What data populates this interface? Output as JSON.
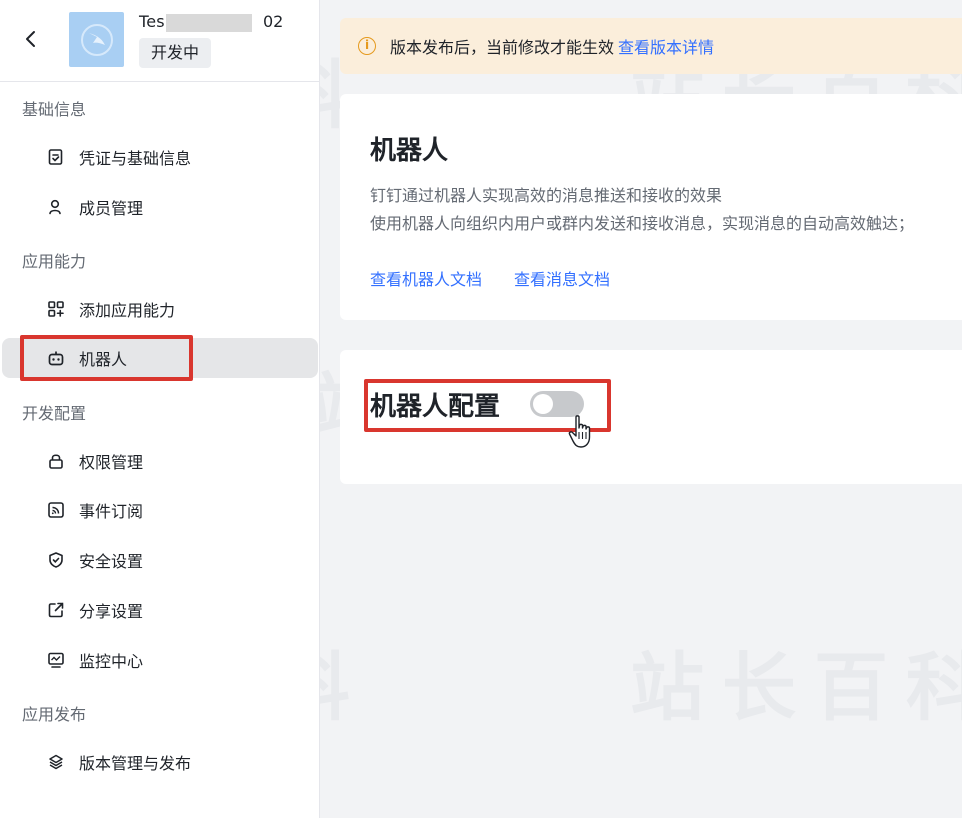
{
  "app": {
    "name_prefix": "Tes",
    "name_suffix": "02",
    "status": "开发中"
  },
  "sidebar": {
    "groups": [
      {
        "title": "基础信息",
        "items": [
          {
            "label": "凭证与基础信息",
            "icon": "credential-icon"
          },
          {
            "label": "成员管理",
            "icon": "user-icon"
          }
        ]
      },
      {
        "title": "应用能力",
        "items": [
          {
            "label": "添加应用能力",
            "icon": "apps-add-icon"
          },
          {
            "label": "机器人",
            "icon": "robot-icon",
            "active": true
          }
        ]
      },
      {
        "title": "开发配置",
        "items": [
          {
            "label": "权限管理",
            "icon": "lock-icon"
          },
          {
            "label": "事件订阅",
            "icon": "rss-icon"
          },
          {
            "label": "安全设置",
            "icon": "shield-icon"
          },
          {
            "label": "分享设置",
            "icon": "share-icon"
          },
          {
            "label": "监控中心",
            "icon": "monitor-icon"
          }
        ]
      },
      {
        "title": "应用发布",
        "items": [
          {
            "label": "版本管理与发布",
            "icon": "layers-icon"
          }
        ]
      }
    ]
  },
  "notice": {
    "text": "版本发布后，当前修改才能生效",
    "link": "查看版本详情"
  },
  "robot_card": {
    "title": "机器人",
    "desc_line1": "钉钉通过机器人实现高效的消息推送和接收的效果",
    "desc_line2": "使用机器人向组织内用户或群内发送和接收消息，实现消息的自动高效触达；",
    "link_robot_docs": "查看机器人文档",
    "link_message_docs": "查看消息文档"
  },
  "config_card": {
    "title": "机器人配置",
    "toggle_on": false
  },
  "watermark": "站长百科",
  "colors": {
    "accent": "#3370ff",
    "highlight": "#d9362e",
    "notice_bg": "#fbeedb",
    "warning": "#e59a1e"
  }
}
